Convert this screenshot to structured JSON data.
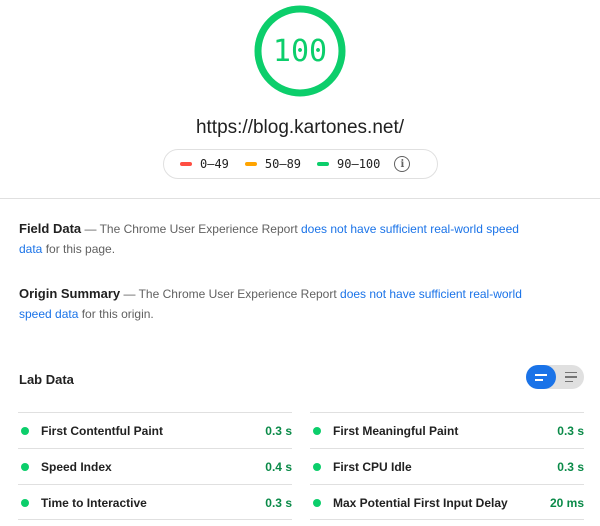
{
  "score": {
    "value": "100",
    "fraction": 1.0,
    "color": "#0cce6b",
    "track_color": "#d9f7e6"
  },
  "url": "https://blog.kartones.net/",
  "legend": {
    "items": [
      {
        "label": "0–49",
        "color": "#ff4e42"
      },
      {
        "label": "50–89",
        "color": "#ffa400"
      },
      {
        "label": "90–100",
        "color": "#0cce6b"
      }
    ],
    "info_icon": "info-icon",
    "info_glyph": "i"
  },
  "field_data": {
    "title": "Field Data",
    "text_before": " — The Chrome User Experience Report ",
    "link": "does not have sufficient real-world speed data",
    "text_after": " for this page."
  },
  "origin_summary": {
    "title": "Origin Summary",
    "text_before": " — The Chrome User Experience Report ",
    "link": "does not have sufficient real-world speed data",
    "text_after": " for this origin."
  },
  "lab_data": {
    "title": "Lab Data",
    "toggle_icons": [
      "compact-view-icon",
      "expanded-view-icon"
    ],
    "metrics_left": [
      {
        "label": "First Contentful Paint",
        "value": "0.3 s"
      },
      {
        "label": "Speed Index",
        "value": "0.4 s"
      },
      {
        "label": "Time to Interactive",
        "value": "0.3 s"
      }
    ],
    "metrics_right": [
      {
        "label": "First Meaningful Paint",
        "value": "0.3 s"
      },
      {
        "label": "First CPU Idle",
        "value": "0.3 s"
      },
      {
        "label": "Max Potential First Input Delay",
        "value": "20 ms"
      }
    ],
    "pass_color": "#0cce6b"
  }
}
